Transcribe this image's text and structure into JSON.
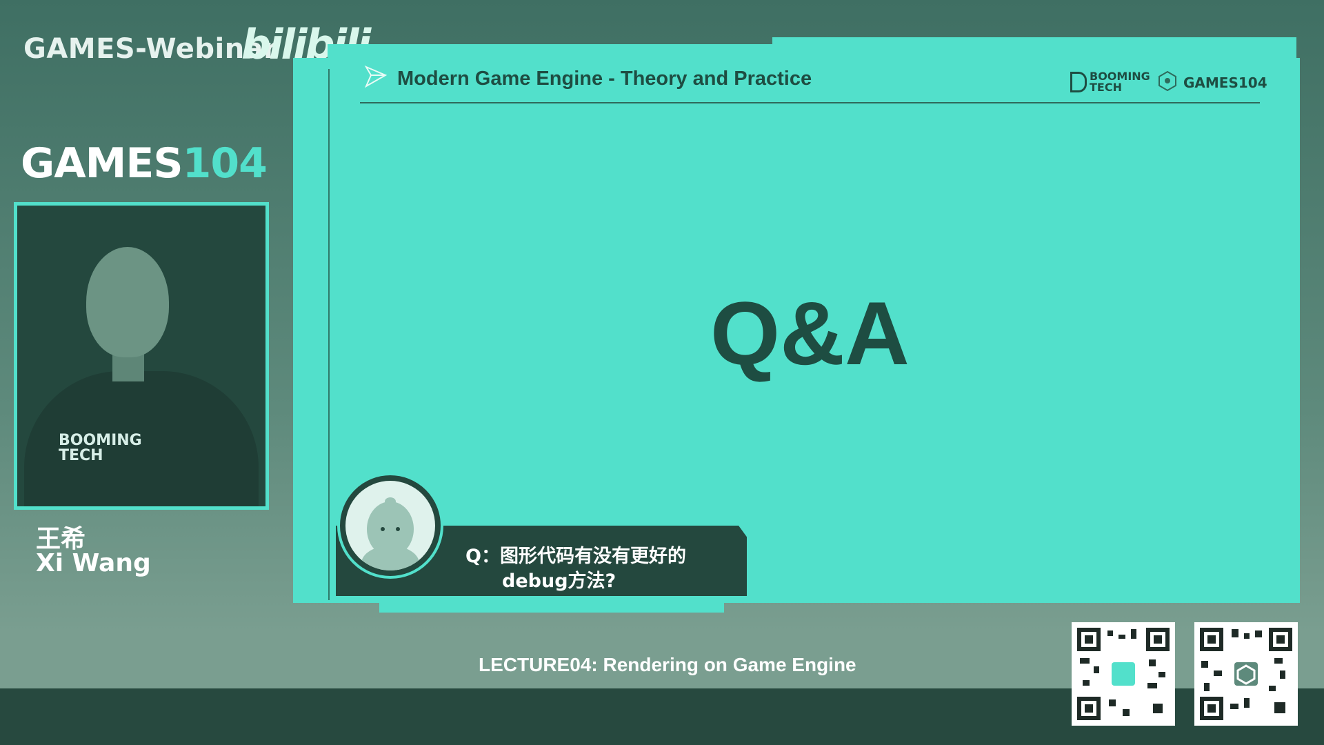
{
  "branding": {
    "webinar": "GAMES-Webinar",
    "bilibili": "bilibili",
    "logo_white": "GAMES",
    "logo_teal": "104"
  },
  "speaker": {
    "name_cn": "王希",
    "name_en": "Xi Wang",
    "shirt_logo_line1": "BOOMING",
    "shirt_logo_line2": "TECH"
  },
  "slide": {
    "course_title": "Modern Game Engine - Theory and Practice",
    "logo_booming_line1": "BOOMING",
    "logo_booming_line2": "TECH",
    "logo_games": "GAMES104",
    "main_text": "Q&A"
  },
  "question": {
    "line1": "Q：图形代码有没有更好的",
    "line2": "debug方法?"
  },
  "footer": {
    "lecture": "LECTURE04: Rendering on Game Engine"
  },
  "colors": {
    "accent": "#52e0cb",
    "dark": "#24483e",
    "text_dark": "#1e4d42"
  },
  "icons": [
    "play-arrow-icon",
    "games-mini-icon",
    "qr-code-icon"
  ]
}
